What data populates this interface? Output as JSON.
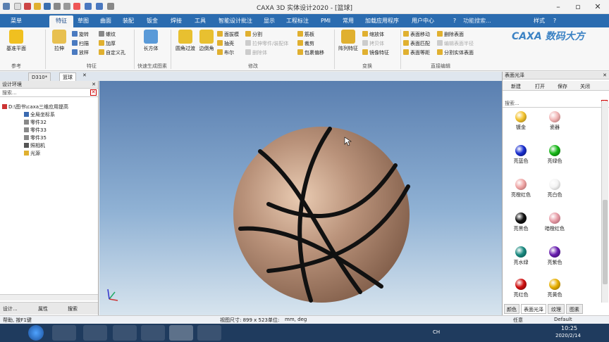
{
  "window": {
    "title": "CAXA 3D 实体设计2020 - [篮球]"
  },
  "menu": {
    "tabs": [
      "菜单",
      "特征",
      "草图",
      "曲面",
      "装配",
      "钣金",
      "焊接",
      "工具",
      "智能设计批注",
      "显示",
      "工程标注",
      "PMI",
      "常用",
      "加载应用程序",
      "用户中心"
    ],
    "search_placeholder": "功能搜索...",
    "style_label": "样式"
  },
  "ribbon": {
    "groups": {
      "reference": "参考",
      "feature": "特征",
      "fast": "快速生成图素",
      "modify": "修改",
      "transform": "变换",
      "direct": "直接编辑"
    },
    "base_plane": "基准平面",
    "extrude": "拉伸",
    "rotate": "旋转",
    "sweep": "扫描",
    "loft": "放样",
    "thread": "螺纹",
    "thicken": "加厚",
    "custom_hole": "自定义孔",
    "cuboid": "长方体",
    "fillet": "圆角过渡",
    "chamfer": "边倒角",
    "draft": "面拔模",
    "shell": "抽壳",
    "boolean": "布尔",
    "split": "分割",
    "stretch_part": "拉伸零件/装配体",
    "delete_body": "删除体",
    "rib": "筋板",
    "trim": "裁剪",
    "wrap": "包裹偏移",
    "pattern": "阵列特征",
    "scale_body": "缩放体",
    "copy_body": "拷贝体",
    "mirror_feature": "镜像特征",
    "face_move": "表面移动",
    "face_match": "表面匹配",
    "face_offset": "表面等距",
    "delete_face": "删除表面",
    "edit_face_radius": "编辑表面半径",
    "split_solid_face": "分割实体表面"
  },
  "logo": "CAXA 数码大方",
  "doc_tabs": [
    "D310*",
    "篮球"
  ],
  "left_panel": {
    "title": "设计环境",
    "search": "搜索...",
    "tree": [
      {
        "label": "D:\\图书\\caxa三维应用提高"
      },
      {
        "label": "全局坐标系"
      },
      {
        "label": "零件32"
      },
      {
        "label": "零件33"
      },
      {
        "label": "零件35"
      },
      {
        "label": "照相机"
      },
      {
        "label": "光源"
      }
    ],
    "tabs": [
      "设计...",
      "属性",
      "搜索"
    ]
  },
  "right_panel": {
    "title": "表面光泽",
    "buttons": [
      "新建",
      "打开",
      "保存",
      "关闭"
    ],
    "search": "搜索...",
    "materials": [
      {
        "name": "镀金",
        "color": "#f4c430"
      },
      {
        "name": "瓷器",
        "color": "#f2b8b8"
      },
      {
        "name": "亮蓝色",
        "color": "#1a2fd0"
      },
      {
        "name": "亮绿色",
        "color": "#18b818"
      },
      {
        "name": "亮橙红色",
        "color": "#f0a8a8"
      },
      {
        "name": "亮白色",
        "color": "#f4f4f4"
      },
      {
        "name": "亮黑色",
        "color": "#111111"
      },
      {
        "name": "暗橙红色",
        "color": "#e89ea8"
      },
      {
        "name": "亮水绿",
        "color": "#1a8a80"
      },
      {
        "name": "亮紫色",
        "color": "#6a20b0"
      },
      {
        "name": "亮红色",
        "color": "#d01010"
      },
      {
        "name": "亮黄色",
        "color": "#e8b000"
      }
    ],
    "tabs": [
      "颜色",
      "表面光泽",
      "纹理",
      "图素"
    ]
  },
  "status": {
    "help": "帮助, 按F1键",
    "view_size": "视图尺寸: 899 x 523",
    "unit_label": "单位:",
    "unit_value": "mm, deg",
    "anywhere": "任意",
    "default": "Default"
  },
  "taskbar": {
    "time": "10:25",
    "date": "2020/2/14",
    "lang": "CH"
  },
  "colors": {
    "accent": "#2b6cb0",
    "ball": "#b08468",
    "seam": "#111111"
  }
}
